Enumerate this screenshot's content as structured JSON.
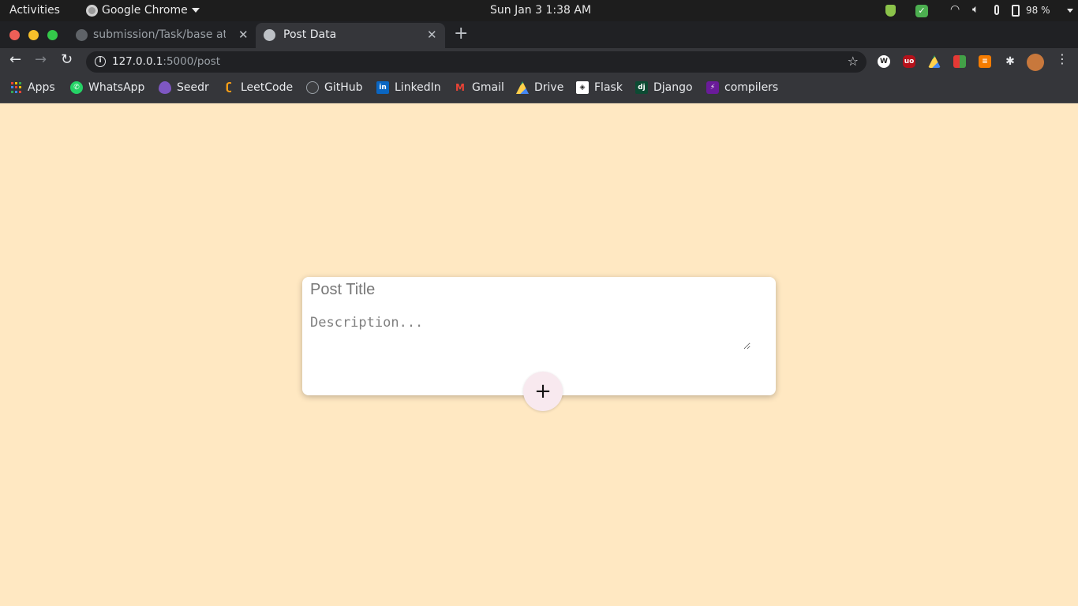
{
  "system_bar": {
    "activities": "Activities",
    "app_name": "Google Chrome",
    "clock": "Sun Jan 3  1:38 AM",
    "battery": "98 %"
  },
  "tabs": [
    {
      "title": "submission/Task/base at",
      "active": false,
      "icon": "github-icon"
    },
    {
      "title": "Post Data",
      "active": true,
      "icon": "globe-icon"
    }
  ],
  "address_bar": {
    "host": "127.0.0.1",
    "path": ":5000/post"
  },
  "bookmarks": [
    {
      "label": "Apps",
      "icon": "apps-grid-icon"
    },
    {
      "label": "WhatsApp",
      "icon": "whatsapp-icon"
    },
    {
      "label": "Seedr",
      "icon": "seedr-icon"
    },
    {
      "label": "LeetCode",
      "icon": "leetcode-icon"
    },
    {
      "label": "GitHub",
      "icon": "github-icon"
    },
    {
      "label": "LinkedIn",
      "icon": "linkedin-icon"
    },
    {
      "label": "Gmail",
      "icon": "gmail-icon"
    },
    {
      "label": "Drive",
      "icon": "drive-icon"
    },
    {
      "label": "Flask",
      "icon": "flask-icon"
    },
    {
      "label": "Django",
      "icon": "django-icon"
    },
    {
      "label": "compilers",
      "icon": "compilers-icon"
    }
  ],
  "form": {
    "title_placeholder": "Post Title",
    "title_value": "",
    "description_placeholder": "Description...",
    "description_value": "",
    "add_label": "+"
  },
  "colors": {
    "page_background": "#ffe8c2",
    "card_background": "#ffffff",
    "add_button_background": "#f8e9ef"
  }
}
